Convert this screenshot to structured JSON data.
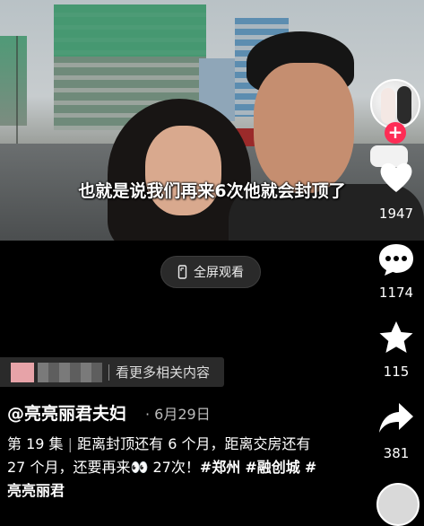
{
  "video": {
    "subtitle": "也就是说我们再来6次他就会封顶了"
  },
  "fullscreen_button": {
    "label": "全屏观看",
    "icon": "fullscreen-phone-icon"
  },
  "sidebar": {
    "follow_icon": "plus-icon",
    "like": {
      "icon": "heart-icon",
      "count": "1947"
    },
    "comment": {
      "icon": "comment-bubble-icon",
      "count": "1174"
    },
    "favorite": {
      "icon": "star-icon",
      "count": "115"
    },
    "share": {
      "icon": "share-arrow-icon",
      "count": "381"
    }
  },
  "related_banner": {
    "label": "看更多相关内容"
  },
  "post": {
    "author": "@亮亮丽君夫妇",
    "date": "6月29日",
    "episode": "第 19 集",
    "caption_part1": "距离封顶还有 6 个月，距离交房还有 27 个月，还要再来",
    "emoji": "👀",
    "caption_part2": "27次！",
    "tags": [
      "#郑州",
      "#融创城",
      "#亮亮丽君"
    ]
  },
  "colors": {
    "background": "#000000",
    "follow_plus": "#fe2c55",
    "banner_bg": "#2a2a2a"
  }
}
